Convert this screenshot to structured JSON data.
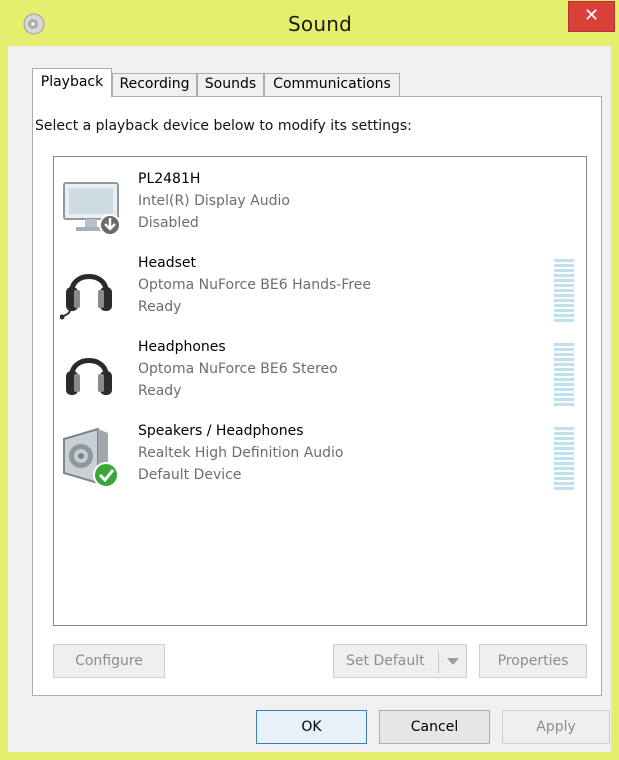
{
  "window": {
    "title": "Sound",
    "close_glyph": "✕"
  },
  "tabs": [
    {
      "label": "Playback",
      "active": true
    },
    {
      "label": "Recording",
      "active": false
    },
    {
      "label": "Sounds",
      "active": false
    },
    {
      "label": "Communications",
      "active": false
    }
  ],
  "playback": {
    "prompt": "Select a playback device below to modify its settings:",
    "devices": [
      {
        "name": "PL2481H",
        "driver": "Intel(R) Display Audio",
        "status": "Disabled",
        "icon": "monitor-icon",
        "badge": "disabled-arrow-badge"
      },
      {
        "name": "Headset",
        "driver": "Optoma NuForce BE6 Hands-Free",
        "status": "Ready",
        "icon": "headset-icon"
      },
      {
        "name": "Headphones",
        "driver": "Optoma NuForce BE6 Stereo",
        "status": "Ready",
        "icon": "headphones-icon"
      },
      {
        "name": "Speakers / Headphones",
        "driver": "Realtek High Definition Audio",
        "status": "Default Device",
        "icon": "speaker-icon",
        "badge": "default-check-badge"
      }
    ],
    "buttons": {
      "configure": "Configure",
      "set_default": "Set Default",
      "properties": "Properties"
    }
  },
  "footer": {
    "ok": "OK",
    "cancel": "Cancel",
    "apply": "Apply"
  },
  "colors": {
    "title_bar": "#e6ee6d",
    "close": "#d9403a",
    "meter": "#bfe0f0",
    "check": "#3aa63a"
  }
}
